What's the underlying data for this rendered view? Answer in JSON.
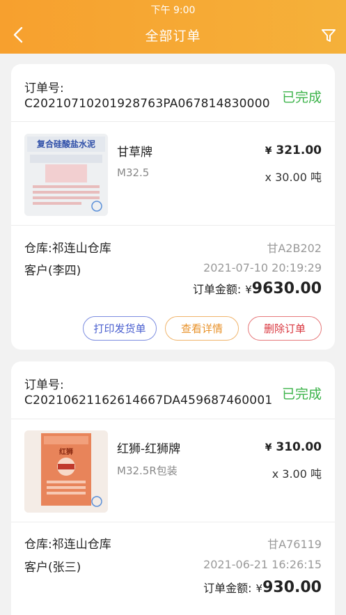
{
  "status_bar": {
    "time": "下午 9:00"
  },
  "header": {
    "title": "全部订单"
  },
  "orders": [
    {
      "order_label": "订单号:",
      "order_no": "C2021071020192876­3PA067814830000",
      "status": "已完成",
      "product": {
        "name": "甘草牌",
        "spec": "M32.5",
        "price_symbol": "¥",
        "price": "321.00",
        "qty": "x 30.00 吨",
        "bag_text": "复合硅酸盐水泥"
      },
      "warehouse": "仓库:祁连山仓库",
      "plate": "甘A2B202",
      "customer": "客户(李四)",
      "datetime": "2021-07-10 20:19:29",
      "total_label": "订单金额:",
      "total_symbol": "¥",
      "total": "9630.00",
      "buttons": {
        "print": "打印发货单",
        "detail": "查看详情",
        "delete": "删除订单"
      }
    },
    {
      "order_label": "订单号:",
      "order_no": "C20210621162614667DA459687460001",
      "status": "已完成",
      "product": {
        "name": "红狮-红狮牌",
        "spec": "M32.5R包装",
        "price_symbol": "¥",
        "price": "310.00",
        "qty": "x 3.00 吨",
        "bag_text": "红狮"
      },
      "warehouse": "仓库:祁连山仓库",
      "plate": "甘A76119",
      "customer": "客户(张三)",
      "datetime": "2021-06-21 16:26:15",
      "total_label": "订单金额:",
      "total_symbol": "¥",
      "total": "930.00"
    }
  ],
  "colors": {
    "header": "#f7a02e",
    "completed": "#3cb34a"
  }
}
